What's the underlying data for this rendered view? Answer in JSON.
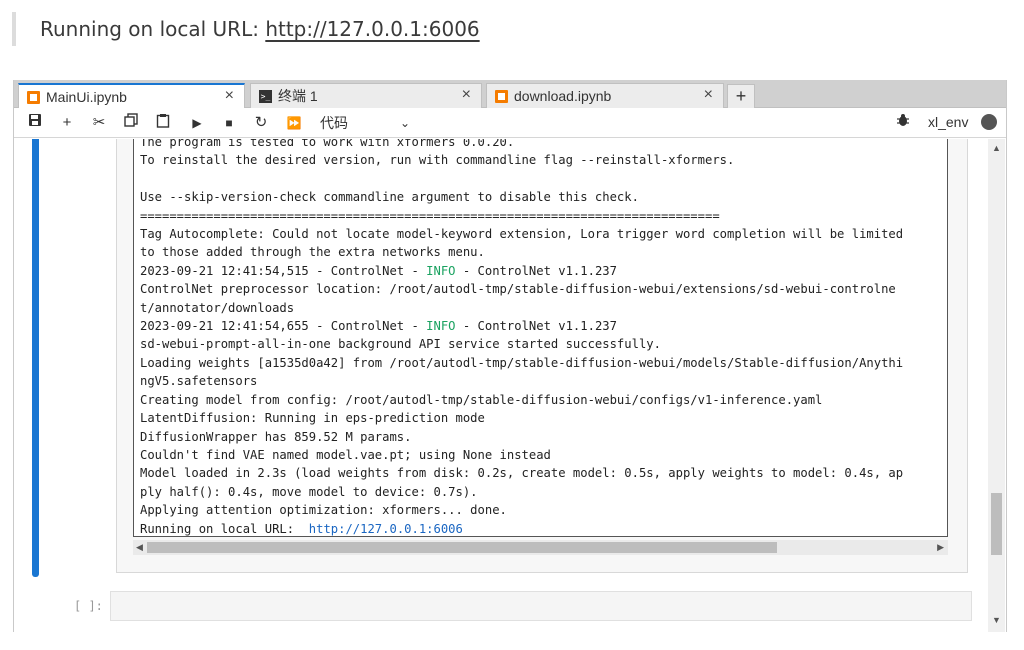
{
  "banner": {
    "prefix": "Running on local URL: ",
    "url": "http://127.0.0.1:6006"
  },
  "tabs": [
    {
      "label": "MainUi.ipynb",
      "icon": "notebook-icon",
      "active": true
    },
    {
      "label": "终端 1",
      "icon": "terminal-icon",
      "active": false
    },
    {
      "label": "download.ipynb",
      "icon": "notebook-icon",
      "active": false
    }
  ],
  "tab_close": "×",
  "add_tab": "+",
  "toolbar": {
    "icons": [
      "save-icon",
      "add-cell-icon",
      "cut-icon",
      "copy-icon",
      "paste-icon",
      "run-icon",
      "stop-icon",
      "restart-icon",
      "run-all-icon"
    ],
    "cell_type": "代码",
    "cell_type_chevron": "⌄",
    "kernel_name": "xl_env"
  },
  "output_lines": [
    "The program is tested to work with xformers 0.0.20.",
    "To reinstall the desired version, run with commandline flag --reinstall-xformers.",
    "",
    "Use --skip-version-check commandline argument to disable this check.",
    "===============================================================================",
    "Tag Autocomplete: Could not locate model-keyword extension, Lora trigger word completion will be limited",
    "to those added through the extra networks menu.",
    "2023-09-21 12:41:54,515 - ControlNet - INFO - ControlNet v1.1.237",
    "ControlNet preprocessor location: /root/autodl-tmp/stable-diffusion-webui/extensions/sd-webui-controlne",
    "t/annotator/downloads",
    "2023-09-21 12:41:54,655 - ControlNet - INFO - ControlNet v1.1.237",
    "sd-webui-prompt-all-in-one background API service started successfully.",
    "Loading weights [a1535d0a42] from /root/autodl-tmp/stable-diffusion-webui/models/Stable-diffusion/Anythi",
    "ngV5.safetensors",
    "Creating model from config: /root/autodl-tmp/stable-diffusion-webui/configs/v1-inference.yaml",
    "LatentDiffusion: Running in eps-prediction mode",
    "DiffusionWrapper has 859.52 M params.",
    "Couldn't find VAE named model.vae.pt; using None instead",
    "Model loaded in 2.3s (load weights from disk: 0.2s, create model: 0.5s, apply weights to model: 0.4s, ap",
    "ply half(): 0.4s, move model to device: 0.7s).",
    "Applying attention optimization: xformers... done.",
    "Running on local URL:  http://127.0.0.1:6006"
  ],
  "next_cell_prompt": "[ ]:",
  "colors": {
    "accent": "#1976d2",
    "info": "#1aa260",
    "link": "#1a66c2"
  }
}
